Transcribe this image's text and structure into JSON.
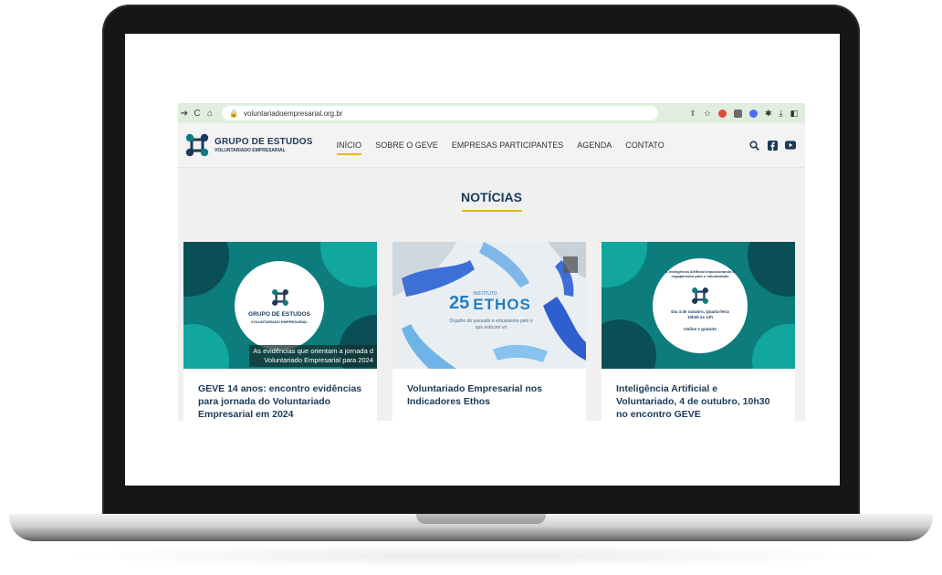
{
  "browser": {
    "url": "voluntariadoempresarial.org.br"
  },
  "site": {
    "logo_line1": "GRUPO DE ESTUDOS",
    "logo_line2": "VOLUNTARIADO EMPRESARIAL",
    "menu": [
      {
        "label": "INÍCIO",
        "active": true
      },
      {
        "label": "SOBRE O GEVE",
        "active": false
      },
      {
        "label": "EMPRESAS PARTICIPANTES",
        "active": false
      },
      {
        "label": "AGENDA",
        "active": false
      },
      {
        "label": "CONTATO",
        "active": false
      }
    ],
    "section_title": "NOTÍCIAS"
  },
  "cards": [
    {
      "title": "GEVE 14 anos: encontro evidências para jornada do Voluntariado Empresarial em 2024",
      "thumb_logo_line1": "GRUPO DE ESTUDOS",
      "thumb_logo_line2": "VOLUNTARIADO EMPRESARIAL",
      "caption_line1": "As evidências que orientam a jornada d",
      "caption_line2": "Voluntariado Empresarial para 2024"
    },
    {
      "title": "Voluntariado Empresarial nos Indicadores Ethos",
      "thumb_number": "25",
      "thumb_brand_small": "INSTITUTO",
      "thumb_brand": "ETHOS",
      "thumb_tagline": "Orgulho do passado e entusiasmo pelo o que está por vir"
    },
    {
      "title": "Inteligência Artificial e Voluntariado, 4 de outubro, 10h30 no encontro GEVE",
      "thumb_heading": "A Inteligência Artificial impulsionando o engajamento para o Voluntariado",
      "thumb_when": "Dia 4 de outubro, Quarta-feira 10h30 às 12h",
      "thumb_price": "Online e gratuito"
    }
  ],
  "colors": {
    "teal": "#0c7d7c",
    "navy": "#1b3a57",
    "accent": "#e6b520",
    "toolbar": "#dfeede"
  }
}
